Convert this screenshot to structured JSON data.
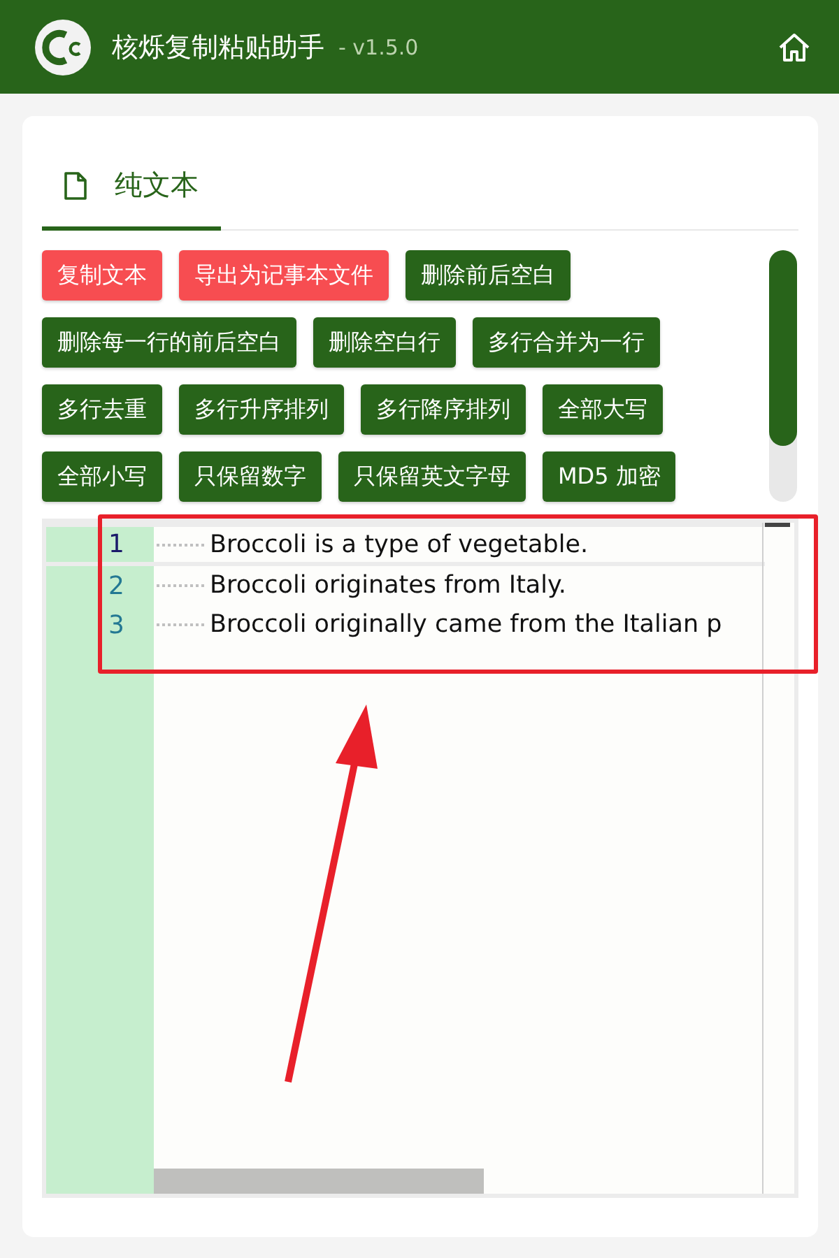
{
  "header": {
    "title": "核烁复制粘贴助手",
    "version": "- v1.5.0"
  },
  "tabs": [
    {
      "label": "纯文本",
      "selected": true
    }
  ],
  "button_rows": [
    [
      {
        "label": "复制文本",
        "kind": "accent"
      },
      {
        "label": "导出为记事本文件",
        "kind": "accent"
      },
      {
        "label": "删除前后空白",
        "kind": "normal"
      }
    ],
    [
      {
        "label": "删除每一行的前后空白",
        "kind": "normal"
      },
      {
        "label": "删除空白行",
        "kind": "normal"
      },
      {
        "label": "多行合并为一行",
        "kind": "normal"
      }
    ],
    [
      {
        "label": "多行去重",
        "kind": "normal"
      },
      {
        "label": "多行升序排列",
        "kind": "normal"
      },
      {
        "label": "多行降序排列",
        "kind": "normal"
      },
      {
        "label": "全部大写",
        "kind": "normal"
      }
    ],
    [
      {
        "label": "全部小写",
        "kind": "normal"
      },
      {
        "label": "只保留数字",
        "kind": "normal"
      },
      {
        "label": "只保留英文字母",
        "kind": "normal"
      },
      {
        "label": "MD5 加密",
        "kind": "normal"
      }
    ]
  ],
  "editor": {
    "lines": [
      {
        "number": "1",
        "text": "Broccoli is a type of vegetable.",
        "current": true
      },
      {
        "number": "2",
        "text": "Broccoli originates from Italy.",
        "current": false
      },
      {
        "number": "3",
        "text": "Broccoli originally came from the Italian p",
        "current": false
      }
    ]
  }
}
